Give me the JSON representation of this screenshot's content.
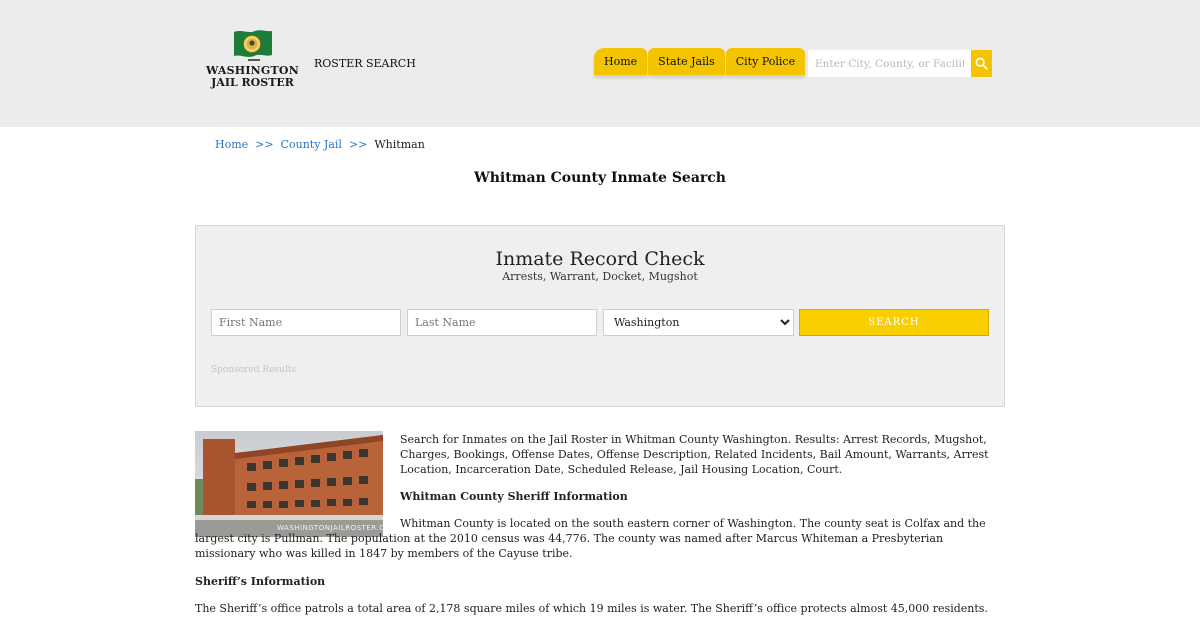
{
  "header": {
    "logo_line1": "WASHINGTON",
    "logo_line2": "JAIL ROSTER",
    "roster_link": "ROSTER SEARCH",
    "nav": [
      {
        "label": "Home"
      },
      {
        "label": "State Jails"
      },
      {
        "label": "City Police"
      }
    ],
    "search_placeholder": "Enter City, County, or Facility"
  },
  "breadcrumb": {
    "home": "Home",
    "sep": ">>",
    "county_jail": "County Jail",
    "current": "Whitman"
  },
  "page_title": "Whitman County Inmate Search",
  "record_check": {
    "title": "Inmate Record Check",
    "subtitle": "Arrests, Warrant, Docket, Mugshot",
    "first_name_placeholder": "First Name",
    "last_name_placeholder": "Last Name",
    "state_selected": "Washington",
    "search_label": "SEARCH",
    "sponsored": "Sponsored Results"
  },
  "content": {
    "photo_watermark": "WASHINGTONJAILROSTER.COM",
    "intro": "Search for Inmates on the Jail Roster in Whitman County Washington. Results: Arrest Records, Mugshot, Charges, Bookings, Offense Dates, Offense Description, Related Incidents, Bail Amount, Warrants, Arrest Location, Incarceration Date, Scheduled Release, Jail Housing Location, Court.",
    "sheriff_heading": "Whitman County Sheriff Information",
    "county_paragraph": "Whitman County is located on the south eastern corner of Washington. The county seat is Colfax and the largest city is Pullman. The population at the 2010 census was 44,776. The county was named after Marcus Whiteman a Presbyterian missionary who was killed in 1847 by members of the Cayuse tribe.",
    "sheriff_info_heading": "Sheriff’s Information",
    "patrol_paragraph": "The Sheriff’s office patrols a total area of 2,178 square miles of which 19 miles is water. The Sheriff’s office protects almost 45,000 residents."
  },
  "colors": {
    "header_bg": "#ececec",
    "accent_yellow": "#f5c400",
    "link_blue": "#2b74c9",
    "flag_green": "#1e7c3a"
  },
  "icons": {
    "logo": "washington-flag-icon",
    "search": "search-icon"
  }
}
